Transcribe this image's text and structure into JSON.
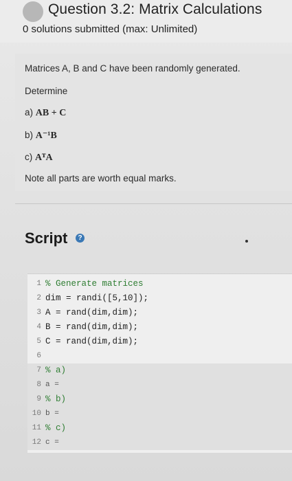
{
  "header": {
    "title": "Question 3.2: Matrix Calculations",
    "subtitle": "0 solutions submitted (max: Unlimited)"
  },
  "description": {
    "intro": "Matrices A, B and C have been randomly generated.",
    "determine": "Determine",
    "parts": [
      {
        "label": "a)",
        "expr": "AB + C"
      },
      {
        "label": "b)",
        "expr": "A⁻¹B"
      },
      {
        "label": "c)",
        "expr": "AᵀA"
      }
    ],
    "note": "Note all parts are worth equal marks."
  },
  "script": {
    "title": "Script",
    "lines": [
      {
        "n": "1",
        "text": "% Generate matrices",
        "kind": "comment"
      },
      {
        "n": "2",
        "text": "dim = randi([5,10]);",
        "kind": "code"
      },
      {
        "n": "3",
        "text": "A = rand(dim,dim);",
        "kind": "code"
      },
      {
        "n": "4",
        "text": "B = rand(dim,dim);",
        "kind": "code"
      },
      {
        "n": "5",
        "text": "C = rand(dim,dim);",
        "kind": "code"
      },
      {
        "n": "6",
        "text": "",
        "kind": "code"
      },
      {
        "n": "7",
        "text": "% a)",
        "kind": "comment"
      },
      {
        "n": "8",
        "text": "a =",
        "kind": "dim"
      },
      {
        "n": "9",
        "text": "% b)",
        "kind": "comment"
      },
      {
        "n": "10",
        "text": "b =",
        "kind": "dim"
      },
      {
        "n": "11",
        "text": "% c)",
        "kind": "comment"
      },
      {
        "n": "12",
        "text": "c =",
        "kind": "dim"
      }
    ]
  }
}
